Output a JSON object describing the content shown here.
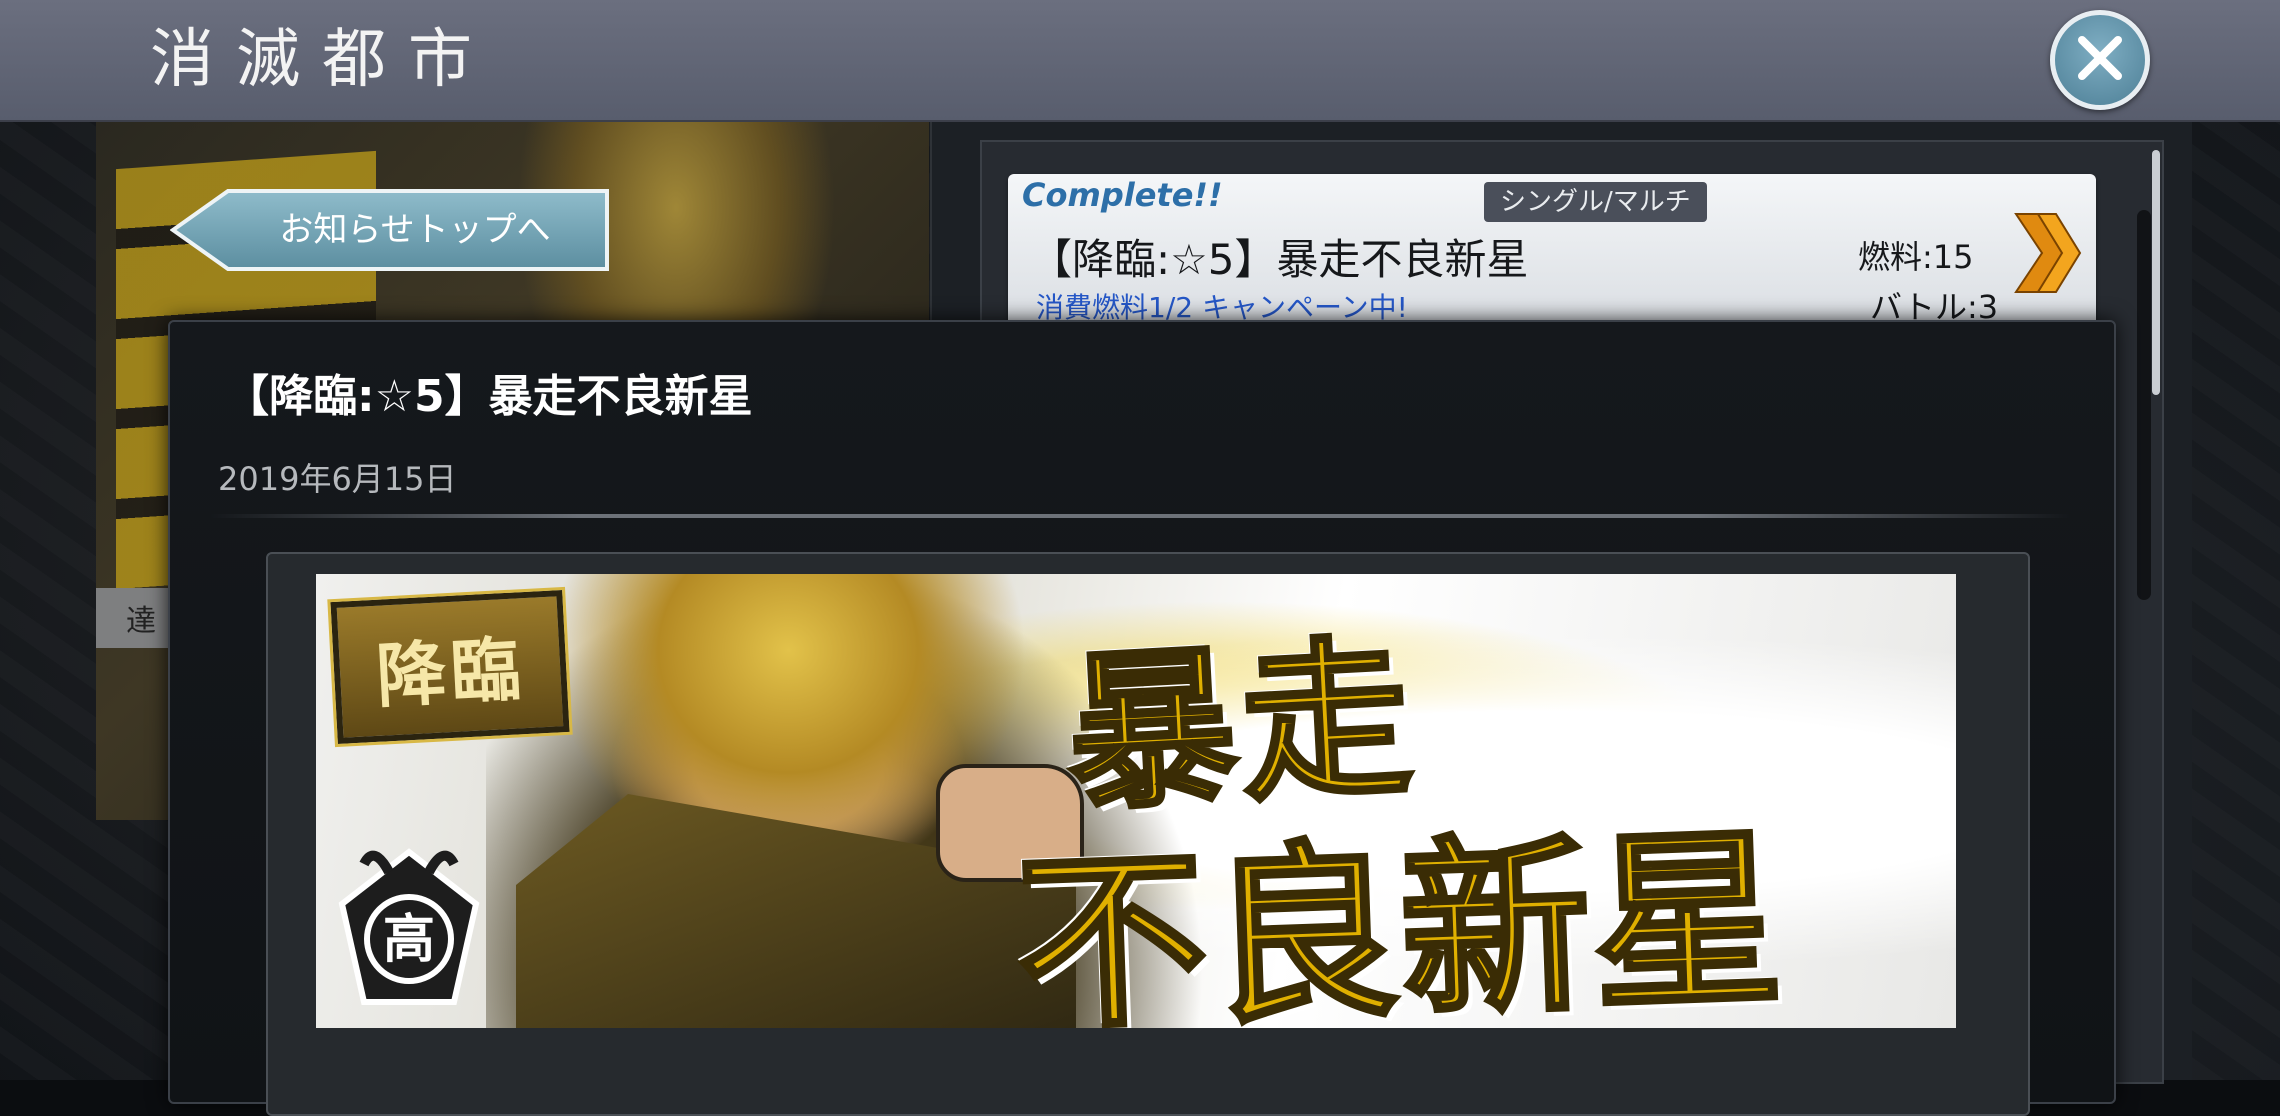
{
  "app": {
    "title": "消滅都市"
  },
  "back_button": {
    "label": "お知らせトップへ"
  },
  "background": {
    "strip_text": "達"
  },
  "event_card": {
    "status": "Complete!!",
    "mode": "シングル/マルチ",
    "title": "【降臨:☆5】暴走不良新星",
    "campaign": "消費燃料1/2 キャンペーン中!",
    "fuel": "燃料:15",
    "battle": "バトル:3"
  },
  "modal": {
    "title": "【降臨:☆5】暴走不良新星",
    "date": "2019年6月15日",
    "banner": {
      "badge": "降臨",
      "crest": "高",
      "headline_line1": "暴走",
      "headline_line2": "不良新星"
    }
  },
  "colors": {
    "top_bar": "#5f6474",
    "close_button": "#5d8ea5",
    "back_button": "#6e9fb0",
    "accent_gold": "#e0b000",
    "campaign_blue": "#2557c7"
  },
  "icons": {
    "close": "close-icon",
    "back": "left-arrow-icon",
    "card_arrow": "double-chevron-right-icon"
  }
}
